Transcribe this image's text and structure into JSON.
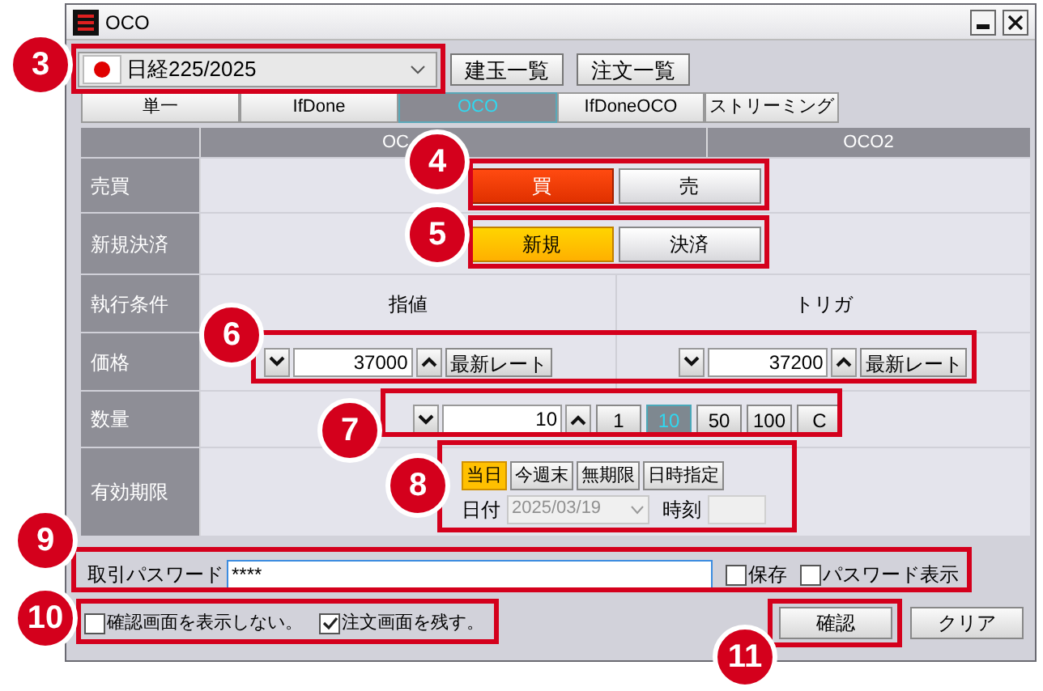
{
  "window": {
    "title": "OCO"
  },
  "instrument": {
    "value": "日経225/2025"
  },
  "top_buttons": [
    "建玉一覧",
    "注文一覧"
  ],
  "tabs": [
    {
      "label": "単一",
      "selected": false
    },
    {
      "label": "IfDone",
      "selected": false
    },
    {
      "label": "OCO",
      "selected": true
    },
    {
      "label": "IfDoneOCO",
      "selected": false
    },
    {
      "label": "ストリーミング",
      "selected": false
    }
  ],
  "columns": [
    "OC",
    "OCO2"
  ],
  "rows": [
    {
      "label": "売買",
      "kind": "side",
      "options": [
        {
          "label": "買",
          "selected": true
        },
        {
          "label": "売",
          "selected": false
        }
      ]
    },
    {
      "label": "新規決済",
      "kind": "trade",
      "options": [
        {
          "label": "新規",
          "selected": true
        },
        {
          "label": "決済",
          "selected": false
        }
      ]
    },
    {
      "label": "執行条件",
      "kind": "conditions",
      "values": [
        "指値",
        "トリガ"
      ]
    },
    {
      "label": "価格",
      "kind": "price",
      "fields": [
        {
          "value": "37000",
          "button": "最新レート"
        },
        {
          "value": "37200",
          "button": "最新レート"
        }
      ]
    },
    {
      "label": "数量",
      "kind": "quantity",
      "value": "10",
      "presets": [
        {
          "label": "1",
          "selected": false
        },
        {
          "label": "10",
          "selected": true
        },
        {
          "label": "50",
          "selected": false
        },
        {
          "label": "100",
          "selected": false
        },
        {
          "label": "C",
          "selected": false
        }
      ]
    },
    {
      "label": "有効期限",
      "kind": "expiry",
      "options": [
        {
          "label": "当日",
          "selected": true
        },
        {
          "label": "今週末",
          "selected": false
        },
        {
          "label": "無期限",
          "selected": false
        },
        {
          "label": "日時指定",
          "selected": false
        }
      ],
      "date_label": "日付",
      "date": "2025/03/19",
      "date_disabled": true,
      "time_label": "時刻",
      "time_disabled": true
    }
  ],
  "password": {
    "label": "取引パスワード",
    "value": "****",
    "options": [
      {
        "label": "保存",
        "checked": false
      },
      {
        "label": "パスワード表示",
        "checked": false
      }
    ]
  },
  "options": [
    {
      "label": "確認画面を表示しない。",
      "checked": false
    },
    {
      "label": "注文画面を残す。",
      "checked": true
    }
  ],
  "actions": [
    "確認",
    "クリア"
  ],
  "callouts": [
    "3",
    "4",
    "5",
    "6",
    "7",
    "8",
    "9",
    "10",
    "11"
  ]
}
